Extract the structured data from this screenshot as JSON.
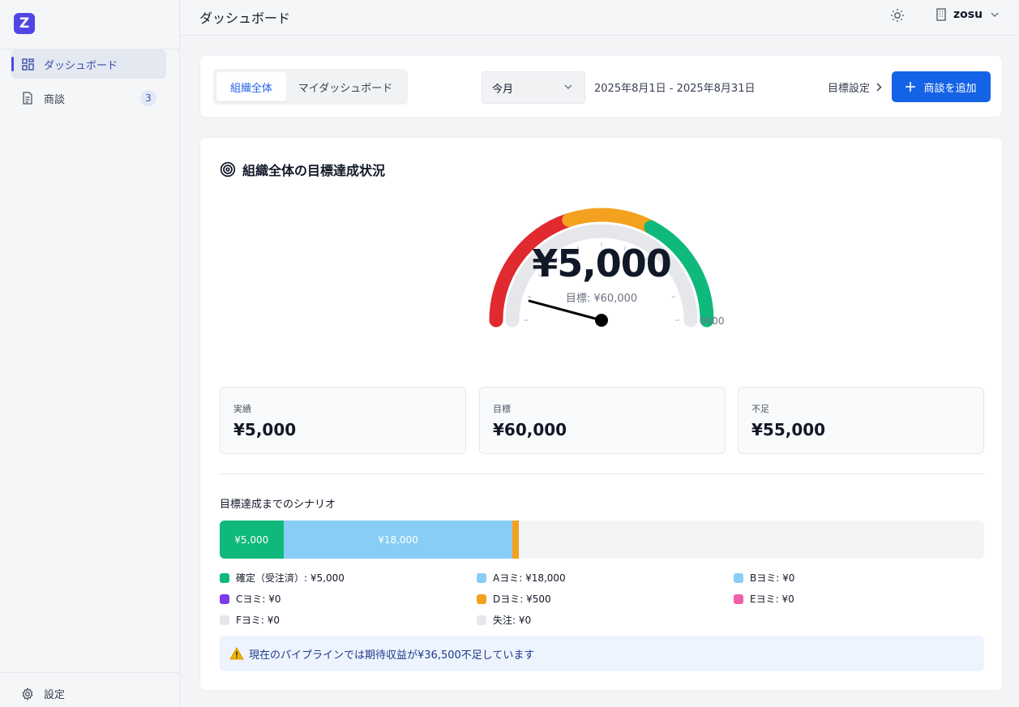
{
  "app": {
    "logo_letter": "Z"
  },
  "sidebar": {
    "items": [
      {
        "label": "ダッシュボード",
        "icon": "grid-icon",
        "active": true
      },
      {
        "label": "商談",
        "icon": "document-icon",
        "badge": "3"
      }
    ],
    "settings_label": "設定"
  },
  "header": {
    "title": "ダッシュボード",
    "org_name": "zosu"
  },
  "toolbar": {
    "tabs": [
      {
        "label": "組織全体",
        "active": true
      },
      {
        "label": "マイダッシュボード",
        "active": false
      }
    ],
    "period_select": "今月",
    "date_range": "2025年8月1日 - 2025年8月31日",
    "goal_link": "目標設定",
    "add_button": "商談を追加"
  },
  "card": {
    "title": "組織全体の目標達成状況",
    "gauge": {
      "value_text": "¥5,000",
      "target_text": "目標: ¥60,000",
      "max_label_fragment": "0000",
      "value": 5000,
      "max": 60000,
      "colors": {
        "red": "#e02a2f",
        "orange": "#f4a11f",
        "green": "#0fb97c",
        "track": "#e5e7eb"
      }
    },
    "stats": [
      {
        "label": "実績",
        "value": "¥5,000"
      },
      {
        "label": "目標",
        "value": "¥60,000"
      },
      {
        "label": "不足",
        "value": "¥55,000"
      }
    ],
    "scenario": {
      "title": "目標達成までのシナリオ",
      "total": 60000,
      "segments": [
        {
          "label": "¥5,000",
          "value": 5000,
          "color": "#0fb97c"
        },
        {
          "label": "¥18,000",
          "value": 18000,
          "color": "#88cdf6"
        },
        {
          "label": "",
          "value": 500,
          "color": "#f4a11f"
        }
      ],
      "legend": [
        {
          "label": "確定（受注済）: ¥5,000",
          "color": "#0fb97c"
        },
        {
          "label": "Aヨミ: ¥18,000",
          "color": "#88cdf6"
        },
        {
          "label": "Bヨミ: ¥0",
          "color": "#88cdf6"
        },
        {
          "label": "Cヨミ: ¥0",
          "color": "#7c3aed"
        },
        {
          "label": "Dヨミ: ¥500",
          "color": "#f4a11f"
        },
        {
          "label": "Eヨミ: ¥0",
          "color": "#f05faa"
        },
        {
          "label": "Fヨミ: ¥0",
          "color": "#e5e7eb"
        },
        {
          "label": "失注: ¥0",
          "color": "#e5e7eb"
        }
      ]
    },
    "warning": {
      "icon": "warning-icon",
      "text": "現在のパイプラインでは期待収益が¥36,500不足しています"
    }
  }
}
